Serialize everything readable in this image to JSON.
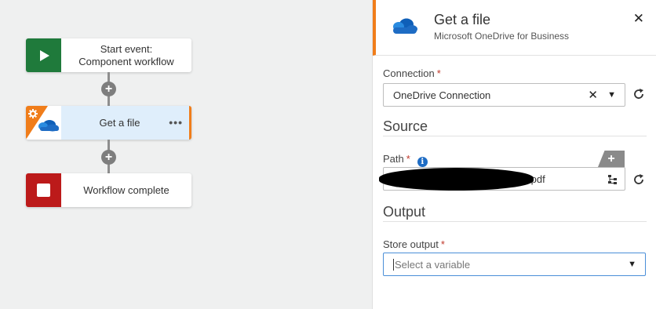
{
  "workflow": {
    "nodes": [
      {
        "line1": "Start event:",
        "line2": "Component workflow",
        "icon": "play-icon"
      },
      {
        "label": "Get a file",
        "more": "•••",
        "icon": "onedrive-gear-icon"
      },
      {
        "label": "Workflow complete",
        "icon": "stop-icon"
      }
    ],
    "add_symbol": "+"
  },
  "panel": {
    "title": "Get a file",
    "subtitle": "Microsoft OneDrive for Business",
    "close": "✕",
    "connection": {
      "label": "Connection",
      "required": "*",
      "value": "OneDrive Connection",
      "clear": "✕",
      "caret": "▼"
    },
    "source_title": "Source",
    "path": {
      "label": "Path",
      "required": "*",
      "info": "i",
      "value_suffix": ".pdf",
      "add": "+"
    },
    "output_title": "Output",
    "store_output": {
      "label": "Store output",
      "required": "*",
      "placeholder": "Select a variable",
      "caret": "▼"
    }
  },
  "colors": {
    "accent": "#f07d1a",
    "start": "#1f7a3b",
    "end": "#bc1a1a",
    "onedrive": "#1e6cc4"
  }
}
